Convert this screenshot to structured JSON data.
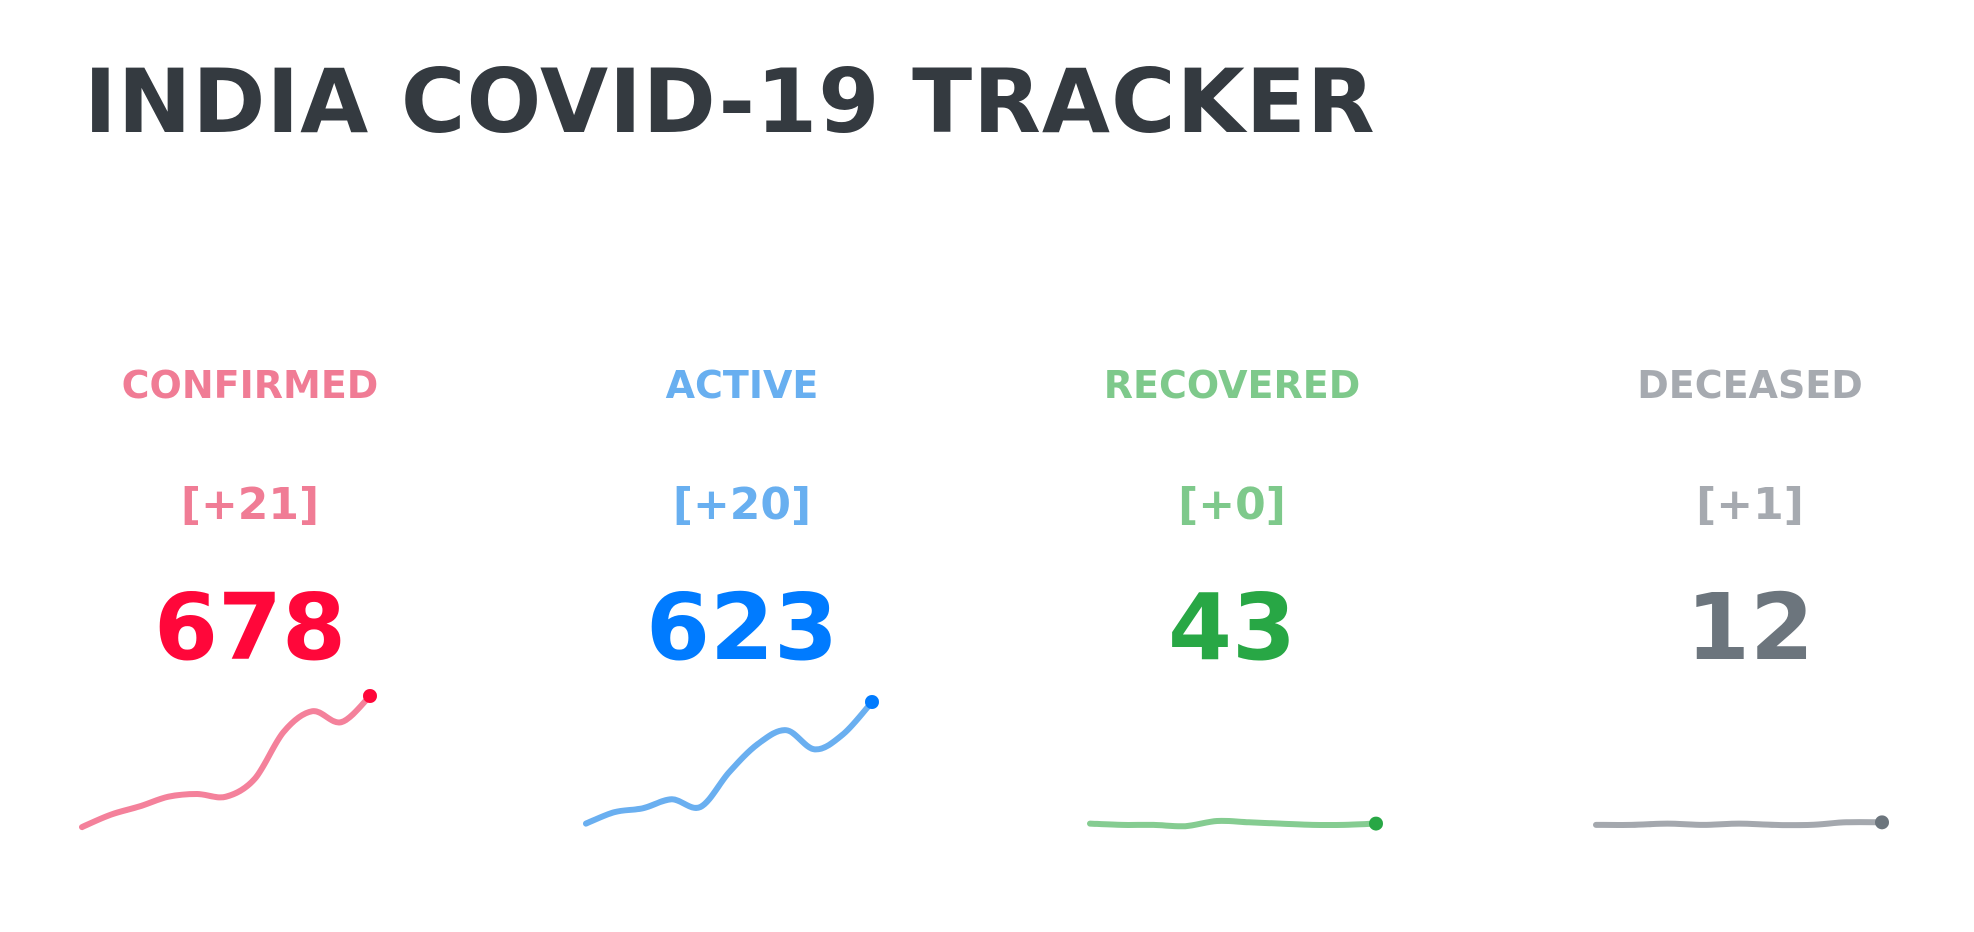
{
  "header": {
    "title": "INDIA COVID-19 TRACKER"
  },
  "stats": [
    {
      "key": "confirmed",
      "label": "CONFIRMED",
      "delta": "[+21]",
      "value": "678",
      "label_color": "#f07c95",
      "value_color": "#ff073a",
      "line_color": "#f4819b",
      "dot_color": "#ff073a",
      "trend": [
        5,
        14,
        20,
        27,
        29,
        27,
        40,
        74,
        89,
        81,
        100
      ]
    },
    {
      "key": "active",
      "label": "ACTIVE",
      "delta": "[+20]",
      "value": "623",
      "label_color": "#68aff0",
      "value_color": "#007bff",
      "line_color": "#6aaff0",
      "dot_color": "#007bff",
      "trend": [
        5,
        14,
        17,
        24,
        18,
        45,
        67,
        78,
        63,
        75,
        100
      ]
    },
    {
      "key": "recovered",
      "label": "RECOVERED",
      "delta": "[+0]",
      "value": "43",
      "label_color": "#7ec98b",
      "value_color": "#28a745",
      "line_color": "#85cc91",
      "dot_color": "#28a745",
      "trend": [
        5,
        4,
        4,
        3,
        7,
        6,
        5,
        4,
        4,
        5
      ]
    },
    {
      "key": "deceased",
      "label": "DECEASED",
      "delta": "[+1]",
      "value": "12",
      "label_color": "#a6aab0",
      "value_color": "#6c757d",
      "line_color": "#a4a8ae",
      "dot_color": "#6c757d",
      "trend": [
        4,
        4,
        5,
        4,
        5,
        4,
        4,
        6,
        6
      ]
    }
  ]
}
